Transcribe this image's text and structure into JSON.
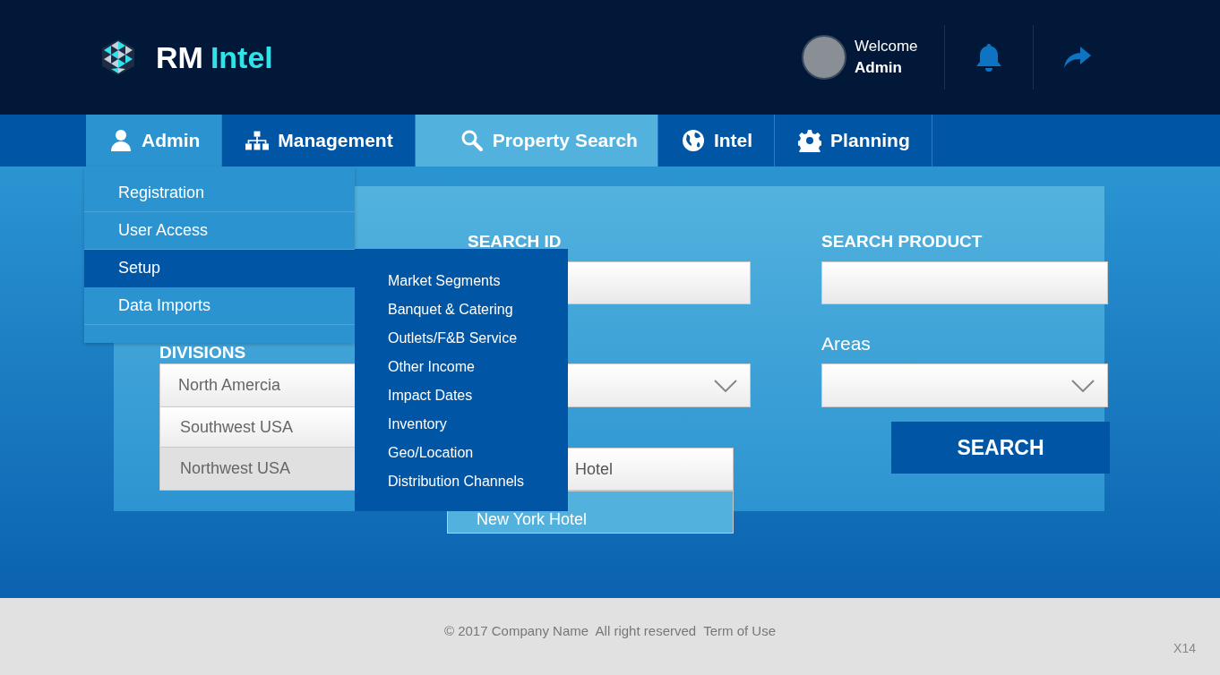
{
  "header": {
    "logo": {
      "part1": "RM",
      "part2": "Intel"
    },
    "user": {
      "greeting": "Welcome",
      "name": "Admin"
    }
  },
  "nav": {
    "tabs": [
      {
        "label": "Admin",
        "selected": false,
        "open": true
      },
      {
        "label": "Management",
        "selected": false,
        "open": false
      },
      {
        "label": "Property Search",
        "selected": true,
        "open": false
      },
      {
        "label": "Intel",
        "selected": false,
        "open": false
      },
      {
        "label": "Planning",
        "selected": false,
        "open": false
      }
    ]
  },
  "admin_menu": {
    "items": [
      {
        "label": "Registration",
        "selected": false
      },
      {
        "label": "User Access",
        "selected": false
      },
      {
        "label": "Setup",
        "selected": true
      },
      {
        "label": "Data Imports",
        "selected": false
      }
    ]
  },
  "setup_submenu": {
    "items": [
      "Market Segments",
      "Banquet & Catering",
      "Outlets/F&B Service",
      "Other Income",
      "Impact Dates",
      "Inventory",
      "Geo/Location",
      "Distribution Channels"
    ]
  },
  "search_panel": {
    "search_id": {
      "label": "SEARCH ID"
    },
    "search_product": {
      "label": "SEARCH PRODUCT"
    },
    "divisions": {
      "label": "DIVISIONS",
      "value": "North Amercia",
      "options": [
        {
          "label": "Southwest USA",
          "highlighted": false
        },
        {
          "label": "Northwest USA",
          "highlighted": true
        }
      ]
    },
    "areas": {
      "label": "Areas"
    },
    "hotel_options": [
      {
        "label": "Hotel",
        "highlighted": false
      },
      {
        "label": "New York Hotel",
        "highlighted": true
      }
    ],
    "search_button": "SEARCH"
  },
  "footer": {
    "copyright": "© 2017 Company Name  All right reserved",
    "link": "Term of Use",
    "page_code": "X14"
  }
}
